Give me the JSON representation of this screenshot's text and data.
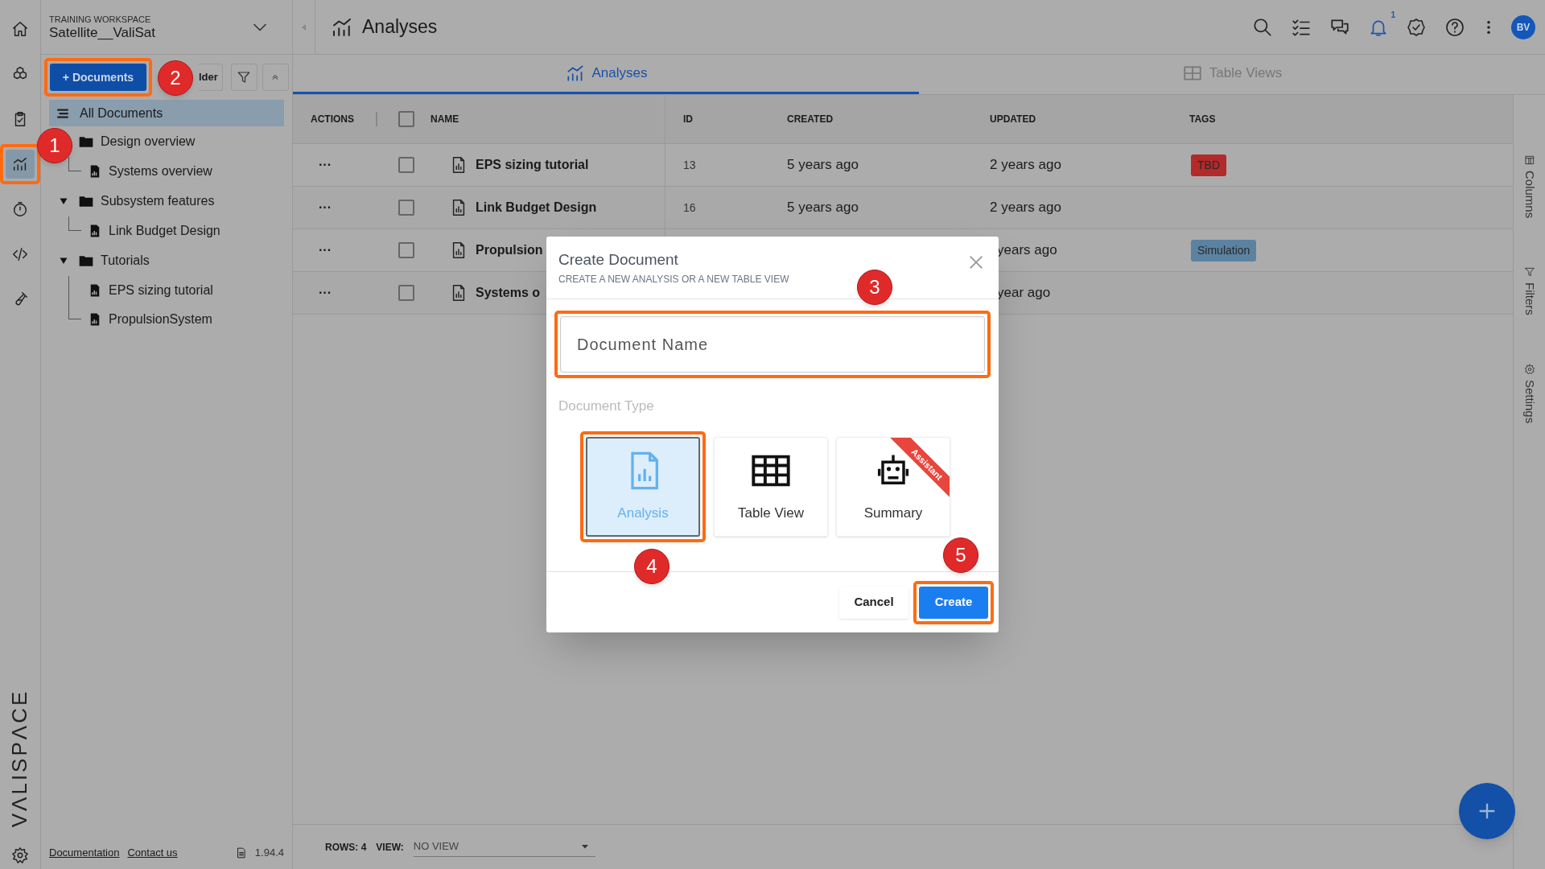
{
  "rail": {
    "items": [
      {
        "selected": false
      },
      {
        "selected": false
      },
      {
        "selected": false
      },
      {
        "selected": true,
        "highlighted": true
      },
      {
        "selected": false
      },
      {
        "selected": false
      },
      {
        "selected": false
      }
    ],
    "logo": "VΛLISPΛCE"
  },
  "workspace": {
    "label": "TRAINING WORKSPACE",
    "name": "Satellite__ValiSat"
  },
  "toolbar": {
    "documents_button": {
      "label": "+ Documents",
      "highlighted": true
    },
    "folder_button": "lder"
  },
  "tree": {
    "root": {
      "label": "All Documents",
      "selected": true
    },
    "items": [
      {
        "label": "Design overview",
        "children": [
          {
            "label": "Systems overview"
          }
        ]
      },
      {
        "label": "Subsystem features",
        "expanded": true,
        "children": [
          {
            "label": "Link Budget Design"
          }
        ]
      },
      {
        "label": "Tutorials",
        "expanded": true,
        "children": [
          {
            "label": "EPS sizing tutorial"
          },
          {
            "label": "PropulsionSystem"
          }
        ]
      }
    ]
  },
  "sidebar_footer": {
    "links": [
      "Documentation",
      "Contact us"
    ],
    "version": "1.94.4"
  },
  "header": {
    "title": "Analyses",
    "notification_count": "1",
    "avatar": "BV"
  },
  "tabs": [
    {
      "label": "Analyses",
      "selected": true
    },
    {
      "label": "Table Views",
      "selected": false
    }
  ],
  "table": {
    "columns": [
      "ACTIONS",
      "NAME",
      "ID",
      "CREATED",
      "UPDATED",
      "TAGS"
    ],
    "select_all_checked": false,
    "rows": [
      {
        "actions": "···",
        "checked": false,
        "name": "EPS sizing tutorial",
        "id": "13",
        "created": "5 years ago",
        "updated": "2 years ago",
        "tags": [
          {
            "label": "TBD",
            "color": "#b22a2a"
          }
        ]
      },
      {
        "actions": "···",
        "checked": false,
        "name": "Link Budget Design",
        "id": "16",
        "created": "5 years ago",
        "updated": "2 years ago"
      },
      {
        "actions": "···",
        "checked": false,
        "name": "Propulsion",
        "updated": "years ago",
        "tags": [
          {
            "label": "Simulation",
            "color": "#5b83a1"
          }
        ]
      },
      {
        "actions": "···",
        "checked": false,
        "name": "Systems o",
        "updated": "year ago"
      }
    ]
  },
  "side_panel": [
    {
      "label": "Columns"
    },
    {
      "label": "Filters"
    },
    {
      "label": "Settings"
    }
  ],
  "footer": {
    "rows_label": "ROWS: 4",
    "view_label": "VIEW:",
    "view_value": "NO VIEW"
  },
  "dialog": {
    "title": "Create Document",
    "subtitle": "CREATE A NEW ANALYSIS OR A NEW TABLE VIEW",
    "name_field": {
      "placeholder": "Document Name",
      "highlighted": true
    },
    "type_label": "Document Type",
    "types": [
      {
        "label": "Analysis",
        "kind": "analysis",
        "selected": true,
        "highlighted": true
      },
      {
        "label": "Table View",
        "kind": "table",
        "selected": false
      },
      {
        "label": "Summary",
        "kind": "summary",
        "selected": false,
        "ribbon": "Assistant"
      }
    ],
    "cancel_button": "Cancel",
    "create_button": {
      "label": "Create",
      "highlighted": true
    }
  },
  "annotations": [
    {
      "number": "1"
    },
    {
      "number": "2"
    },
    {
      "number": "3"
    },
    {
      "number": "4"
    },
    {
      "number": "5"
    }
  ]
}
